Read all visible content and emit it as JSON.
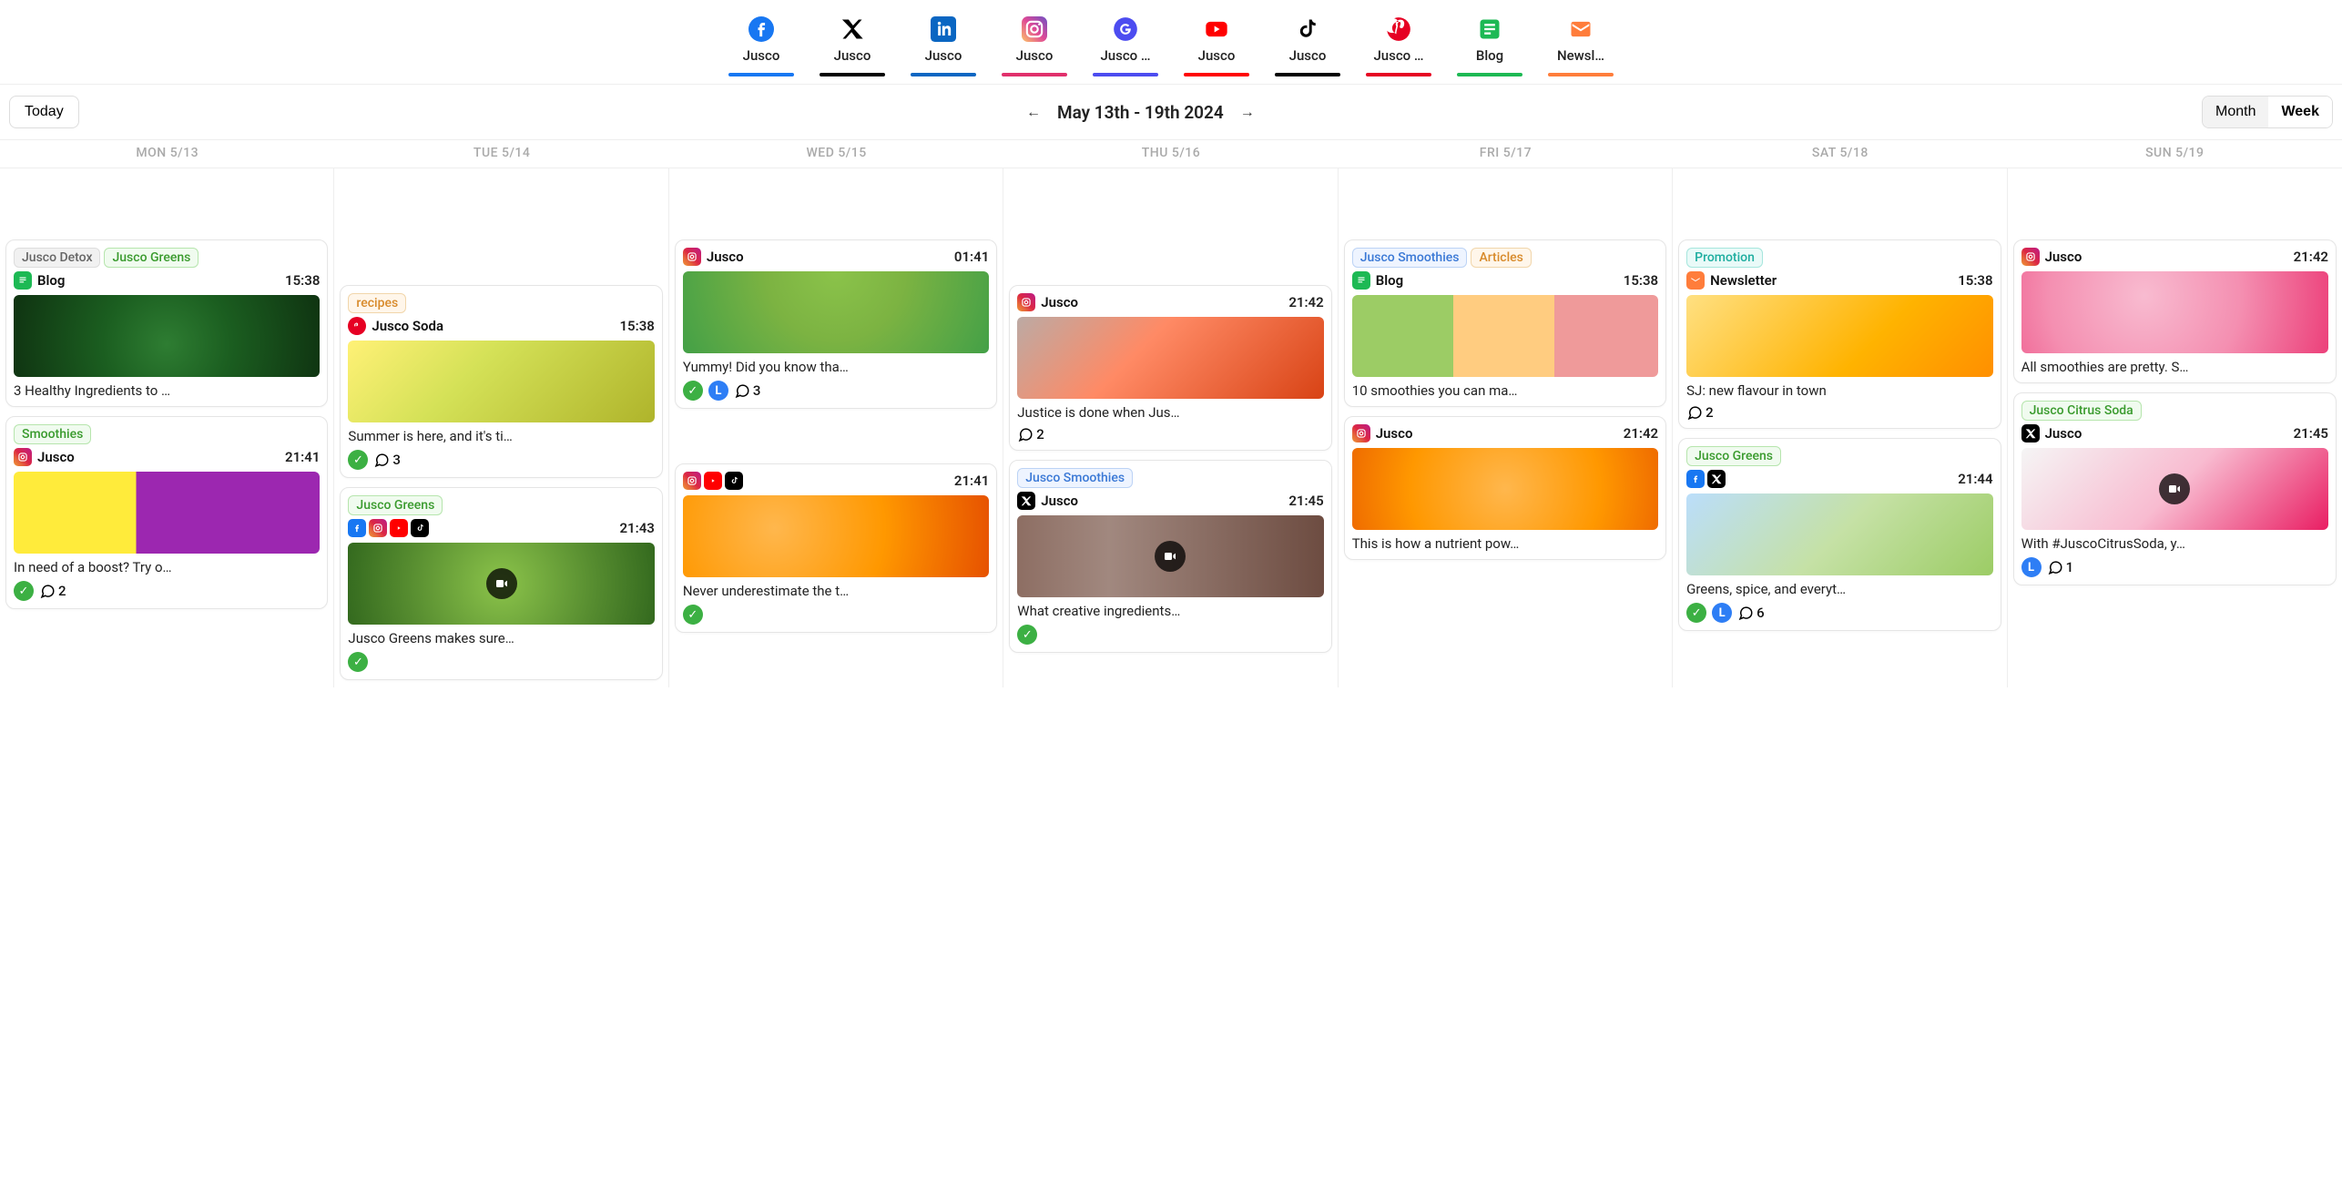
{
  "channels": [
    {
      "id": "facebook",
      "label": "Jusco",
      "color": "#1877f2"
    },
    {
      "id": "x",
      "label": "Jusco",
      "color": "#000"
    },
    {
      "id": "linkedin",
      "label": "Jusco",
      "color": "#0a66c2"
    },
    {
      "id": "instagram",
      "label": "Jusco",
      "color": "#e1306c"
    },
    {
      "id": "google",
      "label": "Jusco …",
      "color": "#4c4cf0"
    },
    {
      "id": "youtube",
      "label": "Jusco",
      "color": "#ff0000"
    },
    {
      "id": "tiktok",
      "label": "Jusco",
      "color": "#000"
    },
    {
      "id": "pinterest",
      "label": "Jusco …",
      "color": "#e60023"
    },
    {
      "id": "blog",
      "label": "Blog",
      "color": "#1db954"
    },
    {
      "id": "newsletter",
      "label": "Newsl…",
      "color": "#ff7d3b"
    }
  ],
  "toolbar": {
    "today": "Today",
    "range": "May 13th - 19th",
    "year": "2024",
    "month": "Month",
    "week": "Week"
  },
  "days": [
    {
      "label": "MON 5/13"
    },
    {
      "label": "TUE 5/14"
    },
    {
      "label": "WED 5/15"
    },
    {
      "label": "THU 5/16"
    },
    {
      "label": "FRI 5/17"
    },
    {
      "label": "SAT 5/18"
    },
    {
      "label": "SUN 5/19"
    }
  ],
  "cards": {
    "mon1": {
      "tags": [
        {
          "text": "Jusco Detox",
          "style": "gray"
        },
        {
          "text": "Jusco Greens",
          "style": "green"
        }
      ],
      "account": "Blog",
      "time": "15:38",
      "caption": "3 Healthy Ingredients to …"
    },
    "mon2": {
      "tags": [
        {
          "text": "Smoothies",
          "style": "green"
        }
      ],
      "account": "Jusco",
      "time": "21:41",
      "caption": "In need of a boost? Try o…",
      "check": true,
      "comments": 2
    },
    "tue1": {
      "tags": [
        {
          "text": "recipes",
          "style": "orange"
        }
      ],
      "account": "Jusco Soda",
      "time": "15:38",
      "caption": "Summer is here, and it's ti…",
      "check": true,
      "comments": 3
    },
    "tue2": {
      "tags": [
        {
          "text": "Jusco Greens",
          "style": "green"
        }
      ],
      "time": "21:43",
      "caption": "Jusco Greens makes sure…",
      "check": true,
      "video": true
    },
    "wed1": {
      "account": "Jusco",
      "time": "01:41",
      "caption": "Yummy! Did you know tha…",
      "check": true,
      "clock": true,
      "comments": 3
    },
    "wed2": {
      "time": "21:41",
      "caption": "Never underestimate the t…",
      "check": true
    },
    "thu1": {
      "account": "Jusco",
      "time": "21:42",
      "caption": "Justice is done when Jus…",
      "comments": 2
    },
    "thu2": {
      "tags": [
        {
          "text": "Jusco Smoothies",
          "style": "blue"
        }
      ],
      "account": "Jusco",
      "time": "21:45",
      "caption": "What creative ingredients…",
      "check": true,
      "video": true
    },
    "fri1": {
      "tags": [
        {
          "text": "Jusco Smoothies",
          "style": "blue"
        },
        {
          "text": "Articles",
          "style": "orange"
        }
      ],
      "account": "Blog",
      "time": "15:38",
      "caption": "10 smoothies you can ma…"
    },
    "fri2": {
      "account": "Jusco",
      "time": "21:42",
      "caption": "This is how a nutrient pow…"
    },
    "sat1": {
      "tags": [
        {
          "text": "Promotion",
          "style": "teal"
        }
      ],
      "account": "Newsletter",
      "time": "15:38",
      "caption": "SJ: new flavour in town",
      "comments": 2
    },
    "sat2": {
      "tags": [
        {
          "text": "Jusco Greens",
          "style": "green"
        }
      ],
      "time": "21:44",
      "caption": "Greens, spice, and everyt…",
      "check": true,
      "clock": true,
      "comments": 6
    },
    "sun1": {
      "account": "Jusco",
      "time": "21:42",
      "caption": "All smoothies are pretty. S…"
    },
    "sun2": {
      "tags": [
        {
          "text": "Jusco Citrus Soda",
          "style": "green"
        }
      ],
      "account": "Jusco",
      "time": "21:45",
      "caption": "With #JuscoCitrusSoda, y…",
      "clock": true,
      "comments": 1,
      "video": true
    }
  }
}
